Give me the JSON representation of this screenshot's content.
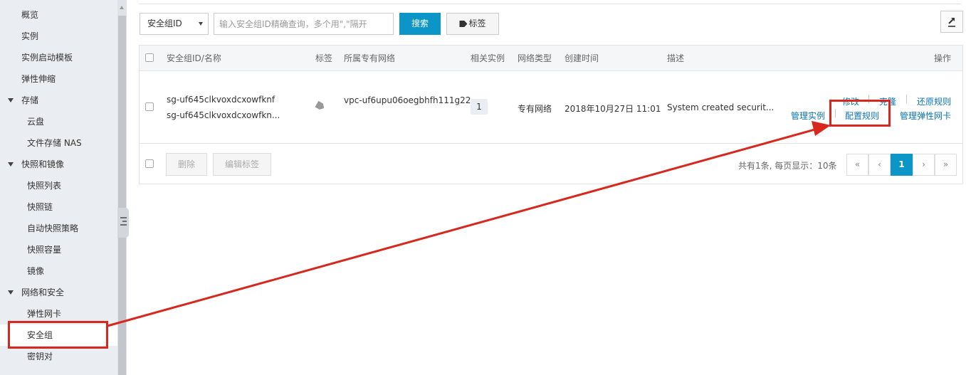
{
  "sidebar": {
    "items": [
      {
        "label": "概览",
        "level": "l1"
      },
      {
        "label": "实例",
        "level": "l1"
      },
      {
        "label": "实例启动模板",
        "level": "l1"
      },
      {
        "label": "弹性伸缩",
        "level": "l1"
      },
      {
        "label": "存储",
        "level": "group"
      },
      {
        "label": "云盘",
        "level": "l2"
      },
      {
        "label": "文件存储 NAS",
        "level": "l2"
      },
      {
        "label": "快照和镜像",
        "level": "group"
      },
      {
        "label": "快照列表",
        "level": "l2"
      },
      {
        "label": "快照链",
        "level": "l2"
      },
      {
        "label": "自动快照策略",
        "level": "l2"
      },
      {
        "label": "快照容量",
        "level": "l2"
      },
      {
        "label": "镜像",
        "level": "l2"
      },
      {
        "label": "网络和安全",
        "level": "group"
      },
      {
        "label": "弹性网卡",
        "level": "l2"
      },
      {
        "label": "安全组",
        "level": "l2",
        "active": true
      },
      {
        "label": "密钥对",
        "level": "l2"
      }
    ]
  },
  "toolbar": {
    "filter_select": "安全组ID",
    "search_placeholder": "输入安全组ID精确查询，多个用\",\"隔开",
    "search_label": "搜索",
    "tag_label": "标签",
    "export_icon": "export-icon"
  },
  "table": {
    "headers": {
      "id_name": "安全组ID/名称",
      "tag": "标签",
      "vpc": "所属专有网络",
      "instances": "相关实例",
      "network_type": "网络类型",
      "created": "创建时间",
      "desc": "描述",
      "ops": "操作"
    },
    "rows": [
      {
        "id": "sg-uf645clkvoxdcxowfknf",
        "name": "sg-uf645clkvoxdcxowfkn...",
        "tag_icon": "tag-icon",
        "vpc": "vpc-uf6upu06oegbhfh111g22",
        "instances": "1",
        "network_type": "专有网络",
        "created": "2018年10月27日 11:01",
        "desc": "System created securit...",
        "ops": {
          "modify": "修改",
          "clone": "克隆",
          "restore": "还原规则",
          "manage_instances": "管理实例",
          "configure_rules": "配置规则",
          "manage_eni": "管理弹性网卡"
        }
      }
    ],
    "footer": {
      "delete_label": "删除",
      "edit_tags_label": "编辑标签",
      "summary": "共有1条, 每页显示：10条",
      "pager": [
        "«",
        "‹",
        "1",
        "›",
        "»"
      ],
      "current_page": "1"
    }
  },
  "colors": {
    "primary": "#0b96c7",
    "link": "#0b75b6",
    "annotation": "#d8281e",
    "sidebar_bg": "#eaedf1"
  }
}
